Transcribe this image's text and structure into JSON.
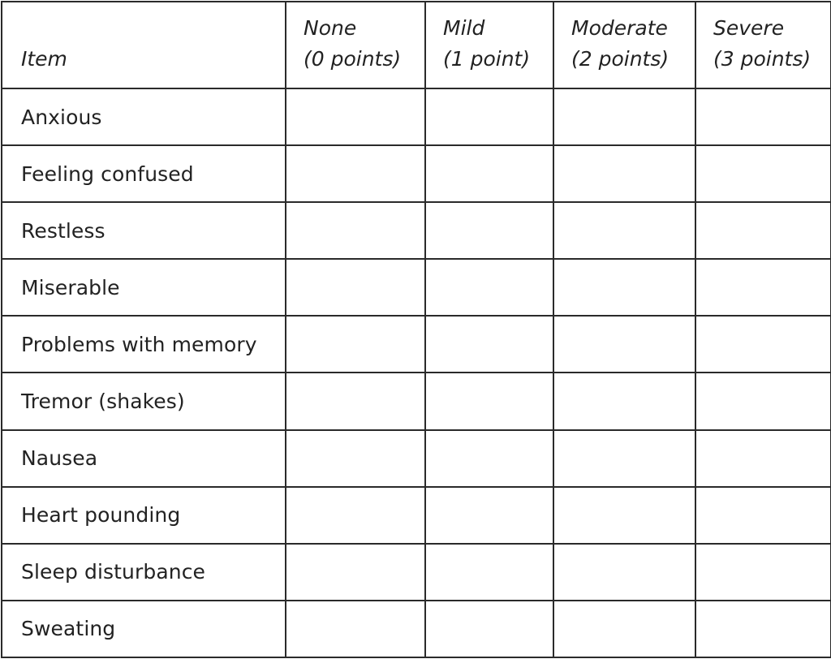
{
  "table": {
    "header": {
      "item_label": "Item",
      "columns": [
        {
          "severity": "None",
          "points": "(0 points)"
        },
        {
          "severity": "Mild",
          "points": "(1 point)"
        },
        {
          "severity": "Moderate",
          "points": "(2 points)"
        },
        {
          "severity": "Severe",
          "points": "(3 points)"
        }
      ]
    },
    "rows": [
      {
        "item": "Anxious"
      },
      {
        "item": "Feeling confused"
      },
      {
        "item": "Restless"
      },
      {
        "item": "Miserable"
      },
      {
        "item": "Problems with memory"
      },
      {
        "item": "Tremor (shakes)"
      },
      {
        "item": "Nausea"
      },
      {
        "item": "Heart pounding"
      },
      {
        "item": "Sleep disturbance"
      },
      {
        "item": "Sweating"
      }
    ]
  }
}
